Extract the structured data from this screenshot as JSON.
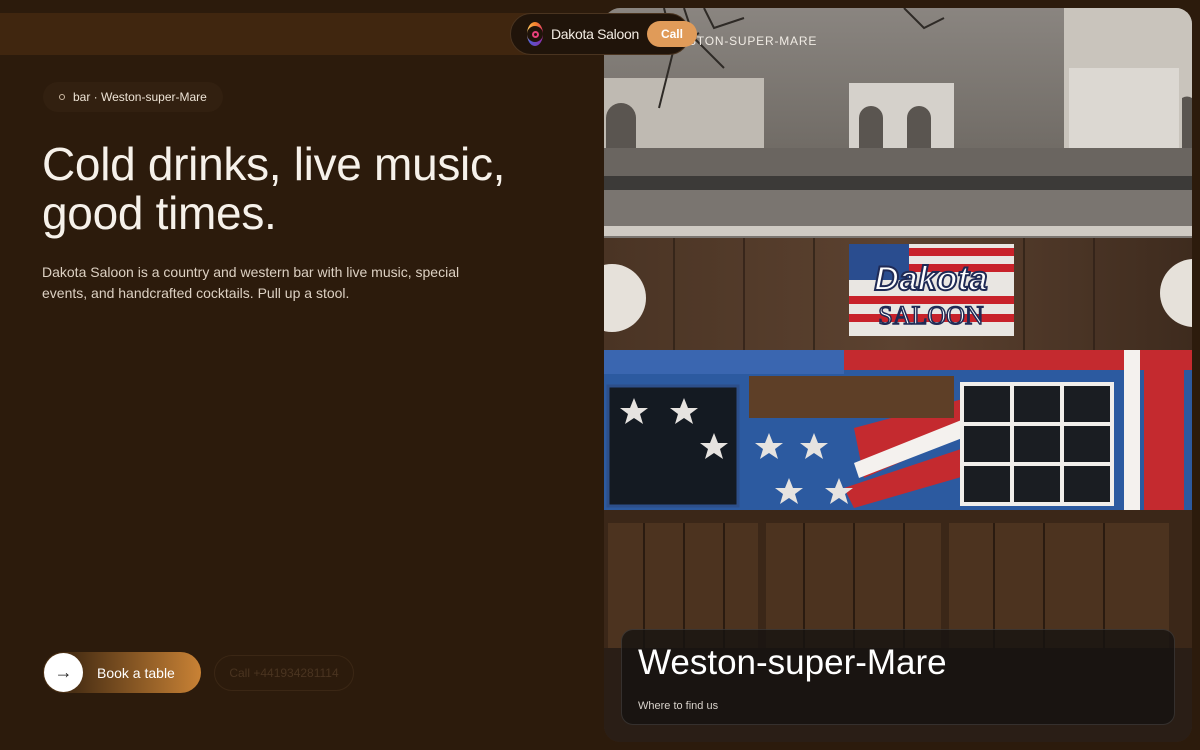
{
  "nav": {
    "brand": "Dakota Saloon",
    "call_label": "Call",
    "instagram_icon": "instagram-icon"
  },
  "hero": {
    "chip": "bar · Weston-super-Mare",
    "headline": "Cold drinks, live music, good times.",
    "description": "Dakota Saloon is a country and western bar with live music, special events, and handcrafted cocktails. Pull up a stool.",
    "book_label": "Book a table",
    "call_label": "Call +441934281114",
    "arrow_icon": "arrow-right-icon"
  },
  "photo": {
    "overlay_label": "STON-SUPER-MARE",
    "sign_line1": "Dakota",
    "sign_line2": "SALOON"
  },
  "location": {
    "title": "Weston-super-Mare",
    "subtitle": "Where to find us"
  },
  "colors": {
    "background": "#2c1b0c",
    "accent": "#e09b59",
    "cta_gradient_end": "#c98235"
  }
}
